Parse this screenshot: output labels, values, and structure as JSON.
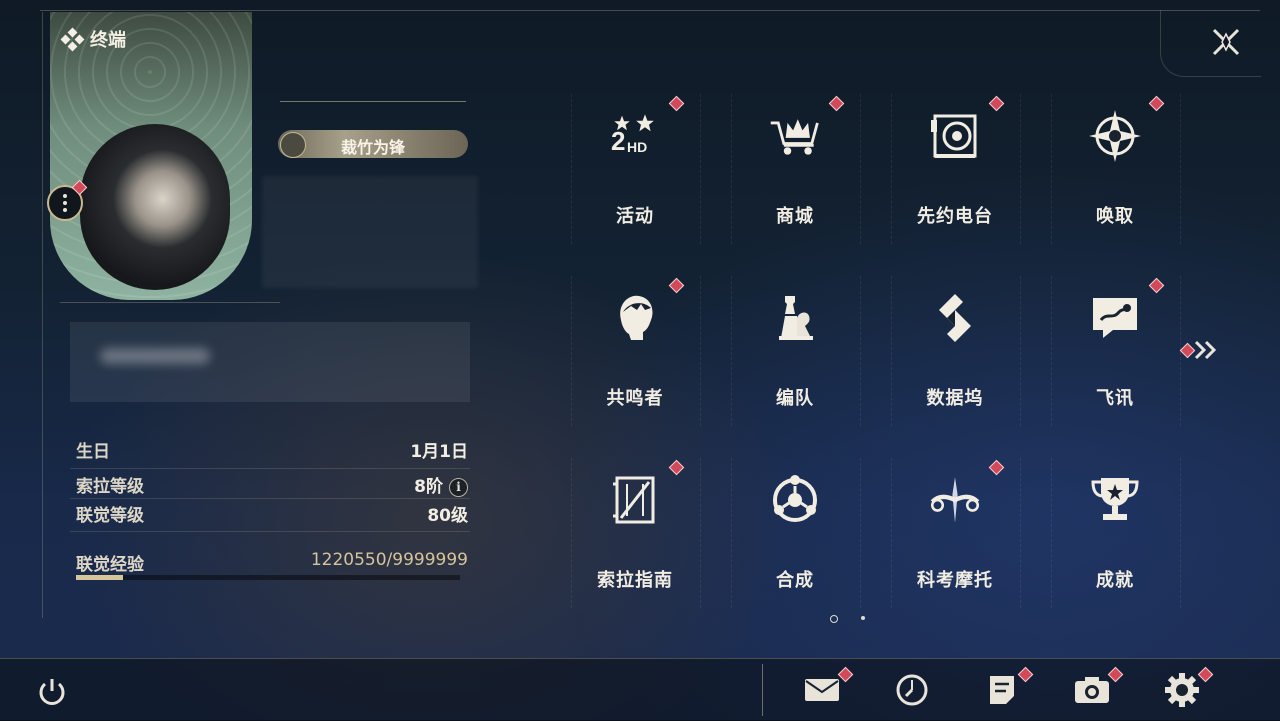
{
  "header": {
    "title": "终端"
  },
  "profile": {
    "title_label": "裁竹为锋",
    "rows": [
      {
        "label": "生日",
        "value": "1月1日"
      },
      {
        "label": "索拉等级",
        "value": "8阶"
      },
      {
        "label": "联觉等级",
        "value": "80级"
      },
      {
        "label": "联觉经验",
        "value": "1220550/9999999"
      }
    ],
    "exp_progress": 0.122
  },
  "grid": [
    {
      "label": "活动",
      "icon": "event-2hd-icon",
      "badge": true
    },
    {
      "label": "商城",
      "icon": "crown-cart-icon",
      "badge": true
    },
    {
      "label": "先约电台",
      "icon": "radio-disc-icon",
      "badge": true
    },
    {
      "label": "唤取",
      "icon": "compass-star-icon",
      "badge": true
    },
    {
      "label": "共鸣者",
      "icon": "character-head-icon",
      "badge": true
    },
    {
      "label": "编队",
      "icon": "chess-pieces-icon",
      "badge": false
    },
    {
      "label": "数据坞",
      "icon": "data-dock-icon",
      "badge": false
    },
    {
      "label": "飞讯",
      "icon": "chat-bubble-icon",
      "badge": true
    },
    {
      "label": "索拉指南",
      "icon": "guide-book-icon",
      "badge": true
    },
    {
      "label": "合成",
      "icon": "synthesis-circle-icon",
      "badge": false
    },
    {
      "label": "科考摩托",
      "icon": "motorbike-icon",
      "badge": true
    },
    {
      "label": "成就",
      "icon": "trophy-icon",
      "badge": false
    }
  ],
  "pagination": {
    "pages": 2,
    "current": 1
  },
  "colors": {
    "badge": "#d24a5a",
    "accent": "#d6c49a",
    "text": "#f1ede3"
  }
}
